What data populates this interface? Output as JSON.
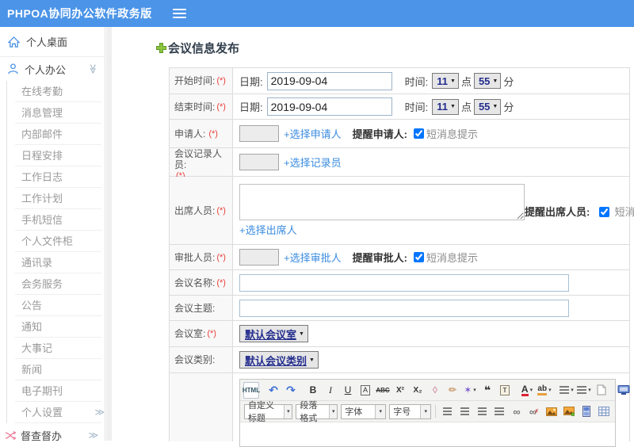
{
  "appearance": {
    "topbar_color": "#4b94e8",
    "icon_blue": "#4a92e5",
    "link_color": "#3a8ce0",
    "required_color": "#e8403a",
    "select_text_color": "#232d8d",
    "plus_green": "#8cc63f",
    "supervise_pink": "#ef7d9a"
  },
  "icons": {
    "select_arrow": "▼",
    "double_chevron": "≫"
  },
  "topbar": {
    "brand": "PHPOA协同办公软件政务版"
  },
  "sidebar": {
    "desktop": "个人桌面",
    "office": "个人办公",
    "sub_items": [
      "在线考勤",
      "消息管理",
      "内部邮件",
      "日程安排",
      "工作日志",
      "工作计划",
      "手机短信",
      "个人文件柜",
      "通讯录",
      "会务服务",
      "公告",
      "通知",
      "大事记",
      "新闻",
      "电子期刊",
      "个人设置"
    ],
    "supervise": "督查督办"
  },
  "page": {
    "title": "会议信息发布"
  },
  "form": {
    "required_mark": "(*)",
    "start_time": {
      "label": "开始时间:",
      "date_label": "日期:",
      "date_value": "2019-09-04",
      "time_label": "时间:",
      "hour": "11",
      "hour_unit": "点",
      "minute": "55",
      "minute_unit": "分"
    },
    "end_time": {
      "label": "结束时间:",
      "date_label": "日期:",
      "date_value": "2019-09-04",
      "time_label": "时间:",
      "hour": "11",
      "hour_unit": "点",
      "minute": "55",
      "minute_unit": "分"
    },
    "applicant": {
      "label": "申请人:",
      "select_link": "+选择申请人",
      "remind_label": "提醒申请人:",
      "sms_label": "短消息提示",
      "checked": true
    },
    "recorder": {
      "label": "会议记录人员:",
      "select_link": "+选择记录员"
    },
    "attendees": {
      "label": "出席人员:",
      "select_link": "+选择出席人",
      "remind_label": "提醒出席人员:",
      "sms_label": "短消息提示",
      "checked": true
    },
    "approver": {
      "label": "审批人员:",
      "select_link": "+选择审批人",
      "remind_label": "提醒审批人:",
      "sms_label": "短消息提示",
      "checked": true
    },
    "meeting_name": {
      "label": "会议名称:"
    },
    "meeting_topic": {
      "label": "会议主题:"
    },
    "meeting_room": {
      "label": "会议室:",
      "value": "默认会议室"
    },
    "meeting_category": {
      "label": "会议类别:",
      "value": "默认会议类别"
    }
  },
  "editor": {
    "buttons": {
      "html": "HTML",
      "bold": "B",
      "italic": "I",
      "underline": "U",
      "border": "A",
      "strike": "ABC",
      "sup": "X²",
      "sub": "X₂",
      "font_color": "A",
      "highlight": "ab"
    },
    "glyphs": {
      "undo": "↶",
      "redo": "↷",
      "eraser": "◊",
      "clean": "✏",
      "wand": "✶",
      "quote": "❝",
      "paste_t": "T",
      "link": "∞",
      "unlink": "∞",
      "unlink_x": "✗"
    },
    "dropdowns": [
      "自定义标题",
      "段落格式",
      "字体",
      "字号"
    ]
  }
}
